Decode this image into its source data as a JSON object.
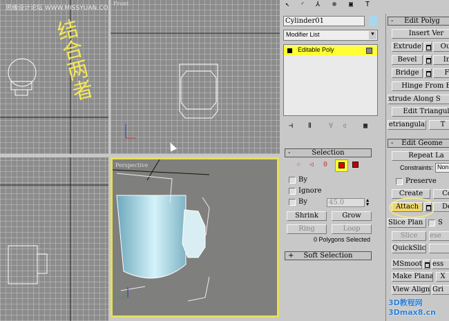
{
  "watermark_top": "思缘设计论坛 WWW.MISSYUAN.COM",
  "handwriting": "结合两者",
  "viewports": {
    "top_left": "",
    "front": "Front",
    "bottom_left": "",
    "perspective": "Perspective"
  },
  "panel": {
    "tabs": [
      "create-icon",
      "modify-icon",
      "hierarchy-icon",
      "motion-icon",
      "display-icon",
      "utilities-icon"
    ],
    "object_name": "Cylinder01",
    "object_color": "#a9d8ec",
    "modifier_list": "Modifier List",
    "stack": [
      {
        "label": "Editable Poly"
      }
    ],
    "selection": {
      "title": "Selection",
      "collapse": "-",
      "by_vertex": "By",
      "ignore": "Ignore",
      "by_angle": "By",
      "angle_value": "45.0",
      "shrink": "Shrink",
      "grow": "Grow",
      "ring": "Ring",
      "loop": "Loop",
      "status": "0 Polygons Selected"
    },
    "soft_selection": {
      "title": "Soft Selection",
      "expand": "+"
    },
    "edit_polygons": {
      "title": "Edit Polyg",
      "collapse": "-",
      "insert_vertex": "Insert Ver",
      "extrude": "Extrude",
      "outline": "Out",
      "bevel": "Bevel",
      "inset": "In",
      "bridge": "Bridge",
      "flip": "F",
      "hinge": "Hinge From E",
      "extrude_along": "xtrude Along S",
      "edit_tri": "Edit Triangul",
      "retri": "etriangula",
      "turn": "T"
    },
    "edit_geometry": {
      "title": "Edit Geome",
      "collapse": "-",
      "repeat": "Repeat La",
      "constraints_label": "Constraints:",
      "constraints_value": "Non",
      "preserve": "Preserve",
      "create": "Create",
      "collapse_btn": "Co",
      "attach": "Attach",
      "detach": "De",
      "slice_plane": "Slice Plan",
      "split": "S",
      "slice": "Slice",
      "reset": "ese",
      "quickslice": "QuickSlice",
      "msmooth": "MSmooth",
      "tess": "ess",
      "make_planar": "Make Planar",
      "x": "X",
      "view_align": "View Align",
      "grid_align": "Gri"
    }
  },
  "logo": "3D教程网 3Dmax8.cn"
}
